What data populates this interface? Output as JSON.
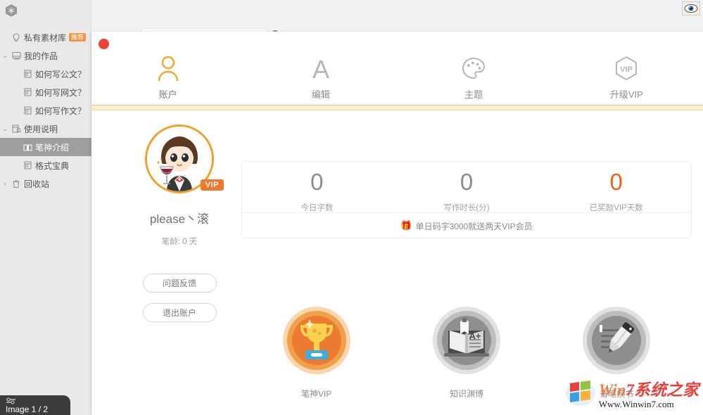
{
  "app": {
    "logo_icon": "hex-logo-icon",
    "eye_icon": "eye-icon"
  },
  "search": {
    "placeholder": "",
    "value": ""
  },
  "sidebar": {
    "items": [
      {
        "label": "私有素材库",
        "icon": "bulb-icon",
        "badge": "推荐",
        "level": 0,
        "twisty": "",
        "selected": false
      },
      {
        "label": "我的作品",
        "icon": "book-icon",
        "badge": "",
        "level": 0,
        "twisty": "⌄",
        "selected": false
      },
      {
        "label": "如何写公文？",
        "icon": "doc-icon",
        "badge": "",
        "level": 1,
        "twisty": "",
        "selected": false
      },
      {
        "label": "如何写网文？",
        "icon": "doc-icon",
        "badge": "",
        "level": 1,
        "twisty": "",
        "selected": false
      },
      {
        "label": "如何写作文？",
        "icon": "doc-icon",
        "badge": "",
        "level": 1,
        "twisty": "",
        "selected": false
      },
      {
        "label": "使用说明",
        "icon": "manual-icon",
        "badge": "",
        "level": 0,
        "twisty": "⌄",
        "selected": false
      },
      {
        "label": "笔神介绍",
        "icon": "open-book-icon",
        "badge": "",
        "level": 1,
        "twisty": "",
        "selected": true
      },
      {
        "label": "格式宝典",
        "icon": "doc-icon",
        "badge": "",
        "level": 1,
        "twisty": "",
        "selected": false
      },
      {
        "label": "回收站",
        "icon": "trash-icon",
        "badge": "",
        "level": 0,
        "twisty": "›",
        "selected": false
      }
    ]
  },
  "modal": {
    "close_icon": "close-dot-icon",
    "tabs": [
      {
        "label": "账户",
        "icon": "user-icon",
        "active": true
      },
      {
        "label": "编辑",
        "icon": "letter-a-icon",
        "active": false
      },
      {
        "label": "主题",
        "icon": "palette-icon",
        "active": false
      },
      {
        "label": "升级VIP",
        "icon": "vip-hex-icon",
        "active": false
      }
    ],
    "profile": {
      "avatar_icon": "avatar-cartoon-icon",
      "vip_badge": "VIP",
      "username": "please丶滚",
      "pen_age": "笔龄: 0 天",
      "feedback_button": "问题反馈",
      "logout_button": "退出账户"
    },
    "stats": [
      {
        "value": "0",
        "label": "今日字数",
        "accent": false
      },
      {
        "value": "0",
        "label": "写作时长(分)",
        "accent": false
      },
      {
        "value": "0",
        "label": "已奖励VIP天数",
        "accent": true
      }
    ],
    "promo": {
      "icon": "gift-icon",
      "text": "单日码字3000就送两天VIP会员"
    },
    "badges": [
      {
        "caption": "笔神VIP",
        "icon": "trophy-medal-icon",
        "earned": true
      },
      {
        "caption": "知识渊博",
        "icon": "book-laptop-icon",
        "earned": false
      },
      {
        "caption": "奋笔疾书",
        "icon": "pencil-medal-icon",
        "earned": false
      }
    ]
  },
  "watermark": {
    "logo_icon": "windows-flag-icon",
    "line1_a": "Win",
    "line1_b": "7",
    "line1_c": "系统之家",
    "line2": "Www.Winwin7.com"
  },
  "overlay": {
    "counter": "Image 1 / 2",
    "icon": "layers-icon"
  },
  "colors": {
    "accent_orange": "#f0792c",
    "vip_orange": "#f0a02a",
    "stat_accent": "#f0601f",
    "close_red": "#ef4136",
    "selected_gray": "#9e9e9e",
    "badge_rec": "#f0933f"
  }
}
